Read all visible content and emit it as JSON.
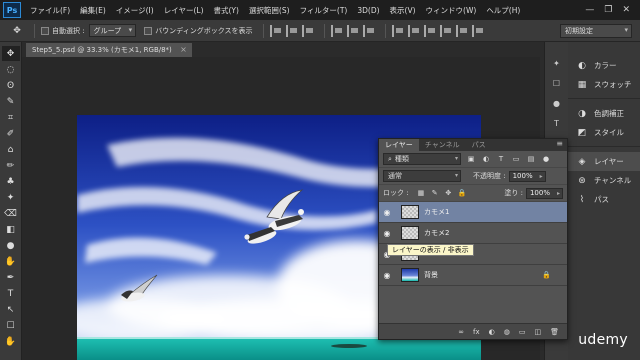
{
  "app": {
    "logo": "Ps"
  },
  "menu": [
    "ファイル(F)",
    "編集(E)",
    "イメージ(I)",
    "レイヤー(L)",
    "書式(Y)",
    "選択範囲(S)",
    "フィルター(T)",
    "3D(D)",
    "表示(V)",
    "ウィンドウ(W)",
    "ヘルプ(H)"
  ],
  "window_controls": {
    "minimize": "—",
    "restore": "❐",
    "close": "✕"
  },
  "options": {
    "auto_select_label": "自動選択 :",
    "auto_select_value": "グループ",
    "bounding_box_label": "バウンディングボックスを表示",
    "workspace": "初期設定"
  },
  "document": {
    "tab_title": "Step5_5.psd @ 33.3% (カモメ1, RGB/8*)",
    "close_glyph": "×"
  },
  "tools": [
    "✥",
    "◌",
    "ʘ",
    "✎",
    "⌗",
    "✐",
    "⌂",
    "✏",
    "♣",
    "✦",
    "⌫",
    "◧",
    "●",
    "✋",
    "✒",
    "T",
    "↖",
    "☐",
    "✋",
    "🔍"
  ],
  "dock": {
    "items": [
      {
        "label": "カラー",
        "icon": "◐"
      },
      {
        "label": "スウォッチ",
        "icon": "▦"
      },
      {
        "label": "色調補正",
        "icon": "◑"
      },
      {
        "label": "スタイル",
        "icon": "◩"
      },
      {
        "label": "レイヤー",
        "icon": "◈"
      },
      {
        "label": "チャンネル",
        "icon": "⊛"
      },
      {
        "label": "パス",
        "icon": "⌇"
      }
    ]
  },
  "layers_panel": {
    "tabs": [
      "レイヤー",
      "チャンネル",
      "パス"
    ],
    "menu_glyph": "≡",
    "filter_kind": "種類",
    "blend_mode": "通常",
    "opacity_label": "不透明度 :",
    "opacity_value": "100%",
    "lock_label": "ロック :",
    "fill_label": "塗り :",
    "fill_value": "100%",
    "layers": [
      {
        "name": "カモメ1"
      },
      {
        "name": "カモメ2"
      },
      {
        "name": ""
      },
      {
        "name": "背景"
      }
    ],
    "tooltip": "レイヤーの表示 / 非表示",
    "footer_icons": [
      "∞",
      "fx",
      "◐",
      "◍",
      "▭",
      "◫",
      "🗑"
    ]
  },
  "watermark": "udemy"
}
